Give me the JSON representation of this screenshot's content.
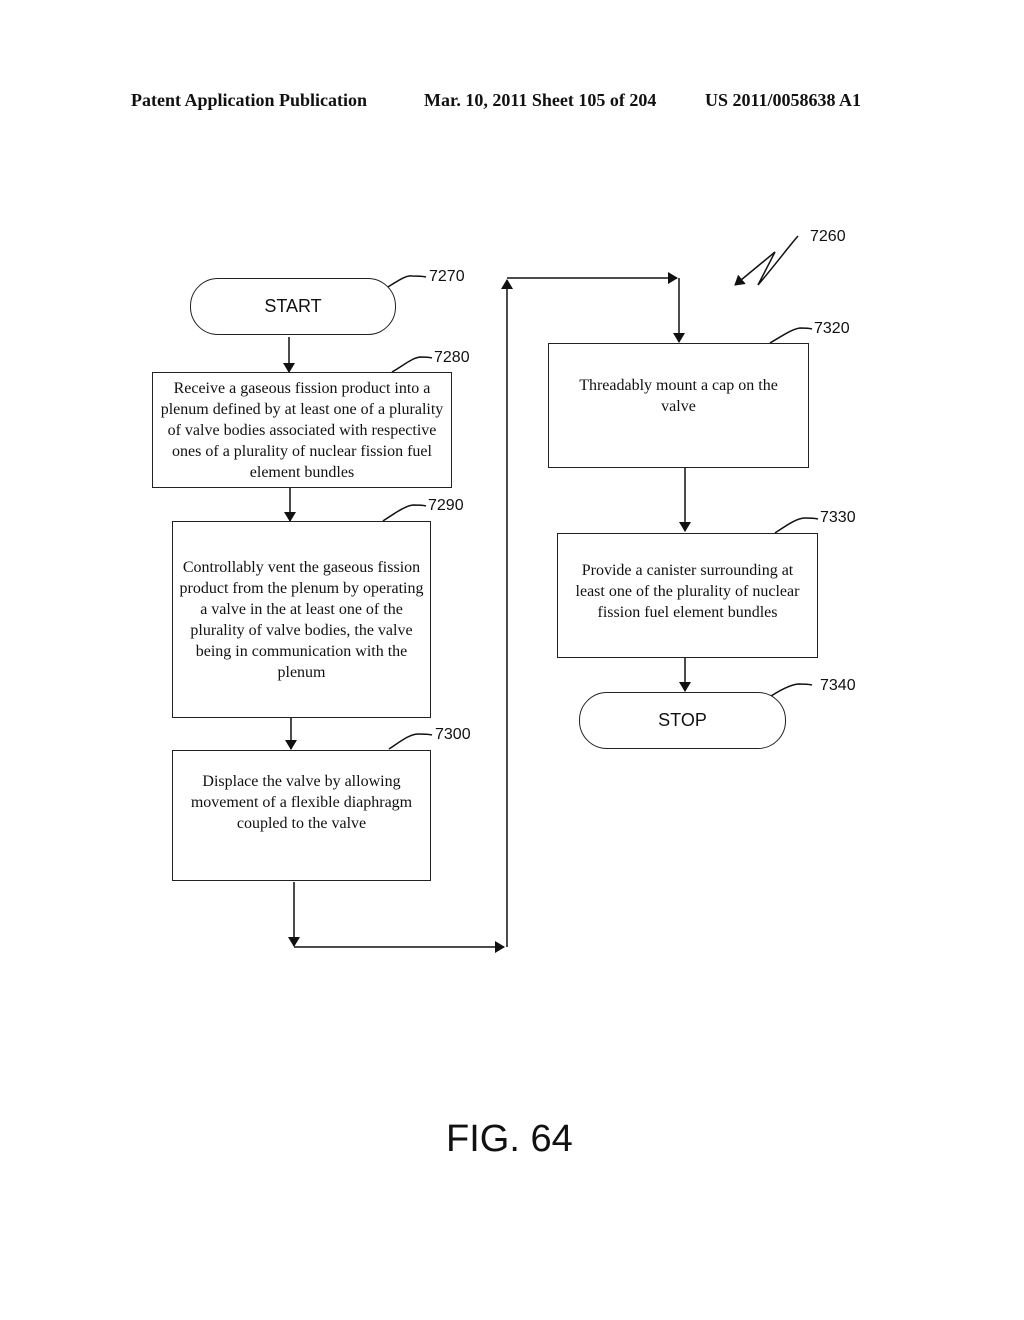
{
  "header": {
    "publication": "Patent Application Publication",
    "date_sheet": "Mar. 10, 2011  Sheet 105 of 204",
    "number": "US 2011/0058638 A1"
  },
  "diagram": {
    "figure_ref": "7260",
    "start": {
      "label": "START",
      "ref": "7270"
    },
    "steps": [
      {
        "ref": "7280",
        "text": "Receive a gaseous fission product into a plenum defined by at least one of a plurality of valve bodies associated with respective ones of a plurality of nuclear fission fuel element bundles"
      },
      {
        "ref": "7290",
        "text": "Controllably vent the gaseous fission product from the plenum by operating a valve in the at least one of the plurality of valve bodies, the valve being in communication with the plenum"
      },
      {
        "ref": "7300",
        "text": "Displace the valve by allowing movement of a flexible diaphragm coupled to the valve"
      },
      {
        "ref": "7320",
        "text": "Threadably mount a cap on the valve"
      },
      {
        "ref": "7330",
        "text": "Provide a canister surrounding at least one of the plurality of nuclear fission fuel element bundles"
      }
    ],
    "stop": {
      "label": "STOP",
      "ref": "7340"
    }
  },
  "figure_label": "FIG. 64"
}
